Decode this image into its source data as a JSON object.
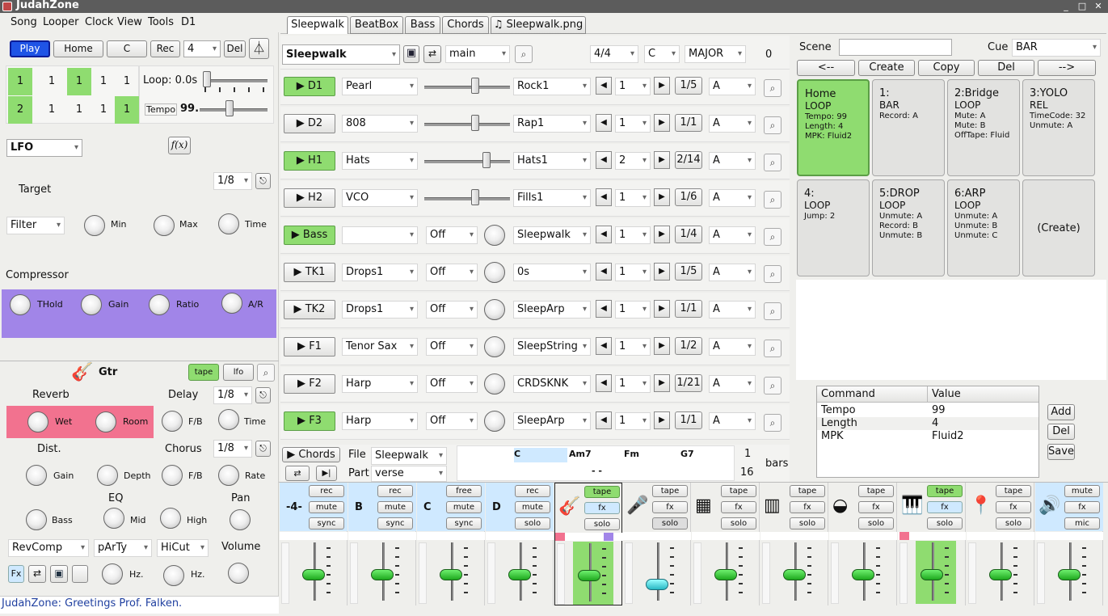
{
  "app": {
    "title": "JudahZone",
    "status": "JudahZone: Greetings Prof. Falken."
  },
  "menu": [
    "Song",
    "Looper",
    "Clock",
    "View",
    "Tools",
    "D1"
  ],
  "transport": {
    "play": "Play",
    "home": "Home",
    "c": "C",
    "rec": "Rec",
    "count": "4",
    "del": "Del",
    "metronome_icon": "metronome-icon"
  },
  "looper_grid": {
    "row1": [
      {
        "v": "1",
        "on": true
      },
      {
        "v": "1",
        "on": false
      },
      {
        "v": "1",
        "on": true
      },
      {
        "v": "1",
        "on": false
      },
      {
        "v": "1",
        "on": false
      }
    ],
    "row2": [
      {
        "v": "2",
        "on": true
      },
      {
        "v": "1",
        "on": false
      },
      {
        "v": "1",
        "on": false
      },
      {
        "v": "1",
        "on": false
      },
      {
        "v": "1",
        "on": true
      }
    ],
    "loop_label": "Loop: 0.0s",
    "tempo_label": "Tempo",
    "tempo_value": "99."
  },
  "lfo": {
    "type": "LFO",
    "fx_btn": "f(x)",
    "target": "Target",
    "division": "1/8",
    "filter": "Filter",
    "min": "Min",
    "max": "Max",
    "time": "Time"
  },
  "compressor": {
    "title": "Compressor",
    "thold": "THold",
    "gain": "Gain",
    "ratio": "Ratio",
    "ar": "A/R"
  },
  "channel": {
    "name": "Gtr",
    "tape": "tape",
    "lfo": "lfo",
    "reverb": "Reverb",
    "delay": "Delay",
    "delay_div": "1/8",
    "wet": "Wet",
    "room": "Room",
    "fb": "F/B",
    "time": "Time",
    "dist": "Dist.",
    "chorus": "Chorus",
    "chorus_div": "1/8",
    "gain": "Gain",
    "depth": "Depth",
    "rate": "Rate",
    "eq": "EQ",
    "pan": "Pan",
    "bass": "Bass",
    "mid": "Mid",
    "high": "High",
    "revcomp": "RevComp",
    "party": "pArTy",
    "hicut": "HiCut",
    "volume": "Volume",
    "hz1": "Hz.",
    "hz2": "Hz.",
    "fx": "Fx"
  },
  "tabs": [
    "Sleepwalk",
    "BeatBox",
    "Bass",
    "Chords",
    "♫ Sleepwalk.png"
  ],
  "song": {
    "name": "Sleepwalk",
    "section": "main",
    "meter": "4/4",
    "key": "C",
    "scale": "MAJOR",
    "num": "0"
  },
  "tracks": [
    {
      "name": "D1",
      "on": true,
      "preset": "Pearl",
      "mode": "slider",
      "slider": 0.6,
      "pattern": "Rock1",
      "step": "1",
      "frac": "1/5",
      "letter": "A"
    },
    {
      "name": "D2",
      "on": false,
      "preset": "808",
      "mode": "slider",
      "slider": 0.6,
      "pattern": "Rap1",
      "step": "1",
      "frac": "1/1",
      "letter": "A"
    },
    {
      "name": "H1",
      "on": true,
      "preset": "Hats",
      "mode": "slider",
      "slider": 0.75,
      "pattern": "Hats1",
      "step": "2",
      "frac": "2/14",
      "letter": "A"
    },
    {
      "name": "H2",
      "on": false,
      "preset": "VCO",
      "mode": "slider",
      "slider": 0.6,
      "pattern": "Fills1",
      "step": "1",
      "frac": "1/6",
      "letter": "A"
    },
    {
      "name": "Bass",
      "on": true,
      "preset": "",
      "mode": "off",
      "off": "Off",
      "pattern": "Sleepwalk",
      "step": "1",
      "frac": "1/4",
      "letter": "A"
    },
    {
      "name": "TK1",
      "on": false,
      "preset": "Drops1",
      "mode": "off",
      "off": "Off",
      "pattern": "0s",
      "step": "1",
      "frac": "1/5",
      "letter": "A"
    },
    {
      "name": "TK2",
      "on": false,
      "preset": "Drops1",
      "mode": "off",
      "off": "Off",
      "pattern": "SleepArp",
      "step": "1",
      "frac": "1/1",
      "letter": "A"
    },
    {
      "name": "F1",
      "on": false,
      "preset": "Tenor Sax",
      "mode": "off",
      "off": "Off",
      "pattern": "SleepString",
      "step": "1",
      "frac": "1/2",
      "letter": "A"
    },
    {
      "name": "F2",
      "on": false,
      "preset": "Harp",
      "mode": "off",
      "off": "Off",
      "pattern": "CRDSKNK",
      "step": "1",
      "frac": "1/21",
      "letter": "A"
    },
    {
      "name": "F3",
      "on": true,
      "preset": "Harp",
      "mode": "off",
      "off": "Off",
      "pattern": "SleepArp",
      "step": "1",
      "frac": "1/1",
      "letter": "A"
    }
  ],
  "chords_bar": {
    "chords_btn": "Chords",
    "file_label": "File",
    "file": "Sleepwalk",
    "part_label": "Part",
    "part": "verse",
    "chords": [
      "C",
      "Am7",
      "Fm",
      "G7"
    ],
    "dashes": "- -",
    "n1": "1",
    "n2": "16",
    "bars": "bars"
  },
  "scene": {
    "label": "Scene",
    "cue_label": "Cue",
    "cue": "BAR",
    "buttons": [
      "<--",
      "Create",
      "Copy",
      "Del",
      "-->"
    ],
    "cards": [
      {
        "title": "Home",
        "type": "LOOP",
        "lines": [
          "Tempo: 99",
          "Length: 4",
          "MPK: Fluid2"
        ],
        "on": true
      },
      {
        "title": "1:",
        "type": "BAR",
        "lines": [
          "Record: A"
        ],
        "on": false
      },
      {
        "title": "2:Bridge",
        "type": "LOOP",
        "lines": [
          "Mute: A",
          "Mute: B",
          "OffTape: Fluid"
        ],
        "on": false
      },
      {
        "title": "3:YOLO",
        "type": "REL",
        "lines": [
          "TimeCode: 32",
          "Unmute: A"
        ],
        "on": false
      },
      {
        "title": "4:",
        "type": "LOOP",
        "lines": [
          "Jump: 2"
        ],
        "on": false
      },
      {
        "title": "5:DROP",
        "type": "LOOP",
        "lines": [
          "Unmute: A",
          "Record: B",
          "Unmute: B"
        ],
        "on": false
      },
      {
        "title": "6:ARP",
        "type": "LOOP",
        "lines": [
          "Unmute: A",
          "Unmute: B",
          "Unmute: C"
        ],
        "on": false
      },
      {
        "title": "(Create)",
        "type": "",
        "lines": [],
        "on": false
      }
    ],
    "table": {
      "headers": [
        "Command",
        "Value"
      ],
      "rows": [
        [
          "Tempo",
          "99"
        ],
        [
          "Length",
          "4"
        ],
        [
          "MPK",
          "Fluid2"
        ]
      ]
    },
    "side": [
      "Add",
      "Del",
      "Save"
    ]
  },
  "mixer": [
    {
      "label": "-4-",
      "kind": "text",
      "top": "blue",
      "btns": [
        "rec",
        "mute",
        "sync"
      ],
      "level": 0.5
    },
    {
      "label": "B",
      "kind": "text",
      "top": "blue",
      "btns": [
        "rec",
        "mute",
        "sync"
      ],
      "level": 0.5
    },
    {
      "label": "C",
      "kind": "text",
      "top": "blue",
      "btns": [
        "free",
        "mute",
        "sync"
      ],
      "level": 0.5
    },
    {
      "label": "D",
      "kind": "text",
      "top": "blue",
      "btns": [
        "rec",
        "mute",
        "solo"
      ],
      "level": 0.5
    },
    {
      "label": "guitar-icon",
      "kind": "icon",
      "glyph": "🎸",
      "top": "none",
      "btns": [
        "tape",
        "fx",
        "solo"
      ],
      "btnon": [
        true,
        "blue",
        false
      ],
      "level": 0.5,
      "selected": true,
      "fill": "green"
    },
    {
      "label": "microphone-icon",
      "kind": "icon",
      "glyph": "🎤",
      "top": "none",
      "btns": [
        "tape",
        "fx",
        "solo"
      ],
      "btnon": [
        false,
        false,
        "grey"
      ],
      "level": 0.3,
      "cyan": true
    },
    {
      "label": "drum-machine-icon",
      "kind": "icon",
      "glyph": "▦",
      "top": "none",
      "btns": [
        "tape",
        "fx",
        "solo"
      ],
      "level": 0.5
    },
    {
      "label": "synth-module-icon",
      "kind": "icon",
      "glyph": "▥",
      "top": "none",
      "btns": [
        "tape",
        "fx",
        "solo"
      ],
      "level": 0.5
    },
    {
      "label": "taco-icon",
      "kind": "icon",
      "glyph": "◒",
      "top": "none",
      "btns": [
        "tape",
        "fx",
        "solo"
      ],
      "level": 0.5
    },
    {
      "label": "keyboard-icon",
      "kind": "icon",
      "glyph": "🎹",
      "top": "none",
      "btns": [
        "tape",
        "fx",
        "solo"
      ],
      "btnon": [
        true,
        "blue",
        false
      ],
      "level": 0.5,
      "fill": "green"
    },
    {
      "label": "pin-icon",
      "kind": "icon",
      "glyph": "📍",
      "top": "none",
      "btns": [
        "tape",
        "fx",
        "solo"
      ],
      "level": 0.5
    },
    {
      "label": "speakers-icon",
      "kind": "icon",
      "glyph": "🔊",
      "top": "blue",
      "btns": [
        "mute",
        "fx",
        "mic"
      ],
      "level": 0.5
    }
  ]
}
